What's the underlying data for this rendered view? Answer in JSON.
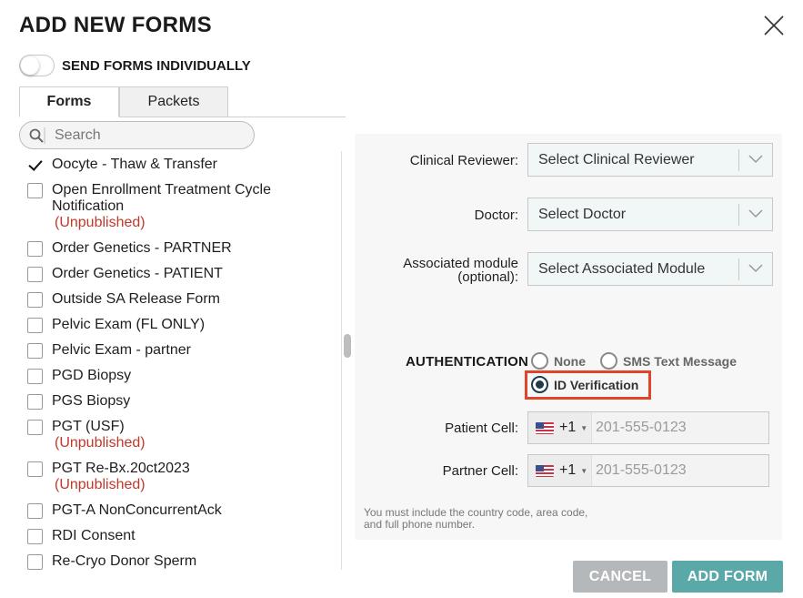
{
  "dialog": {
    "title": "ADD NEW FORMS"
  },
  "send_individually": {
    "label": "SEND FORMS INDIVIDUALLY",
    "enabled": false
  },
  "tabs": [
    {
      "label": "Forms",
      "active": true
    },
    {
      "label": "Packets",
      "active": false
    }
  ],
  "search": {
    "placeholder": "Search",
    "value": ""
  },
  "forms": [
    {
      "label": "Oocyte - Thaw & Transfer",
      "checked": true,
      "status": ""
    },
    {
      "label": "Open Enrollment Treatment Cycle Notification",
      "checked": false,
      "status": "(Unpublished)"
    },
    {
      "label": "Order Genetics - PARTNER",
      "checked": false,
      "status": ""
    },
    {
      "label": "Order Genetics - PATIENT",
      "checked": false,
      "status": ""
    },
    {
      "label": "Outside SA Release Form",
      "checked": false,
      "status": ""
    },
    {
      "label": "Pelvic Exam (FL ONLY)",
      "checked": false,
      "status": ""
    },
    {
      "label": "Pelvic Exam - partner",
      "checked": false,
      "status": ""
    },
    {
      "label": "PGD Biopsy",
      "checked": false,
      "status": ""
    },
    {
      "label": "PGS Biopsy",
      "checked": false,
      "status": ""
    },
    {
      "label": "PGT (USF)",
      "checked": false,
      "status": "(Unpublished)"
    },
    {
      "label": "PGT Re-Bx.20ct2023",
      "checked": false,
      "status": "(Unpublished)"
    },
    {
      "label": "PGT-A NonConcurrentAck",
      "checked": false,
      "status": ""
    },
    {
      "label": "RDI Consent",
      "checked": false,
      "status": ""
    },
    {
      "label": "Re-Cryo Donor Sperm",
      "checked": false,
      "status": ""
    }
  ],
  "fields": {
    "clinical_reviewer": {
      "label": "Clinical Reviewer:",
      "placeholder": "Select Clinical Reviewer"
    },
    "doctor": {
      "label": "Doctor:",
      "placeholder": "Select Doctor"
    },
    "associated_module": {
      "label_line1": "Associated module",
      "label_line2": "(optional):",
      "placeholder": "Select Associated Module"
    }
  },
  "authentication": {
    "label": "AUTHENTICATION",
    "options": [
      {
        "label": "None",
        "selected": false
      },
      {
        "label": "SMS Text Message",
        "selected": false
      },
      {
        "label": "ID Verification",
        "selected": true
      }
    ],
    "highlight_color": "#e0442a"
  },
  "phones": {
    "patient": {
      "label": "Patient Cell:",
      "country_code": "+1",
      "placeholder": "201-555-0123",
      "flag": "us-flag-icon"
    },
    "partner": {
      "label": "Partner Cell:",
      "country_code": "+1",
      "placeholder": "201-555-0123",
      "flag": "us-flag-icon"
    }
  },
  "note": "You must include the country code, area code, and full phone number.",
  "buttons": {
    "cancel": "CANCEL",
    "add": "ADD FORM"
  },
  "colors": {
    "primary": "#5aa8a8",
    "cancel": "#b5b8bb",
    "unpublished": "#c0392b"
  }
}
